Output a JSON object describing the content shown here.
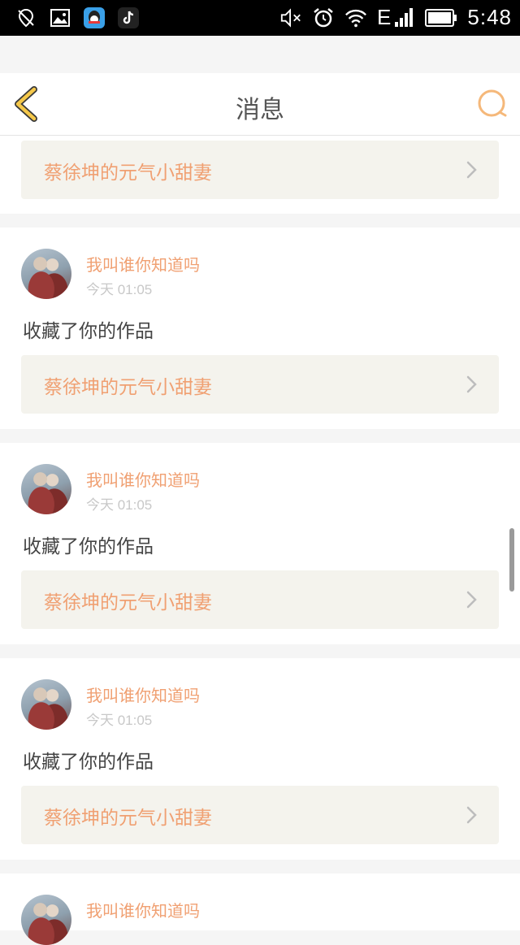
{
  "status_bar": {
    "network": "E",
    "time": "5:48",
    "left_icons": [
      "location-off-icon",
      "image-icon",
      "qq-icon",
      "tiktok-icon"
    ],
    "right_icons": [
      "mute-icon",
      "alarm-icon",
      "wifi-icon",
      "signal-icon",
      "battery-icon"
    ]
  },
  "header": {
    "title": "消息",
    "accent_color": "#f5c84a",
    "search_color": "#f5b87a"
  },
  "top_card": {
    "work_title": "蔡徐坤的元气小甜妻"
  },
  "messages": [
    {
      "username": "我叫谁你知道吗",
      "time": "今天 01:05",
      "action": "收藏了你的作品",
      "work_title": "蔡徐坤的元气小甜妻"
    },
    {
      "username": "我叫谁你知道吗",
      "time": "今天 01:05",
      "action": "收藏了你的作品",
      "work_title": "蔡徐坤的元气小甜妻"
    },
    {
      "username": "我叫谁你知道吗",
      "time": "今天 01:05",
      "action": "收藏了你的作品",
      "work_title": "蔡徐坤的元气小甜妻"
    }
  ],
  "partial_message": {
    "username": "我叫谁你知道吗"
  },
  "colors": {
    "username": "#f0a072",
    "work_box_bg": "#f4f3ed",
    "page_bg": "#f5f5f5"
  }
}
